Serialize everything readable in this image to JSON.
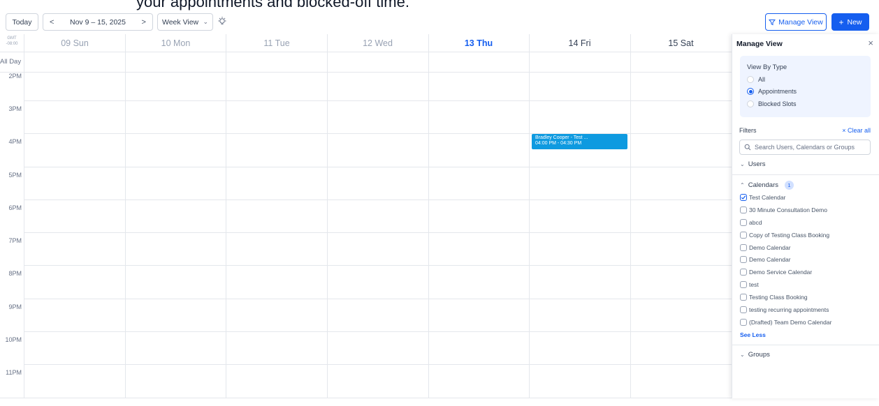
{
  "caption": "your appointments and blocked-off time.",
  "toolbar": {
    "today_label": "Today",
    "prev_arrow": "<",
    "next_arrow": ">",
    "date_range": "Nov 9 – 15, 2025",
    "view_label": "Week View",
    "manage_view_label": "Manage View",
    "new_label": "New"
  },
  "calendar": {
    "timezone": "GMT -08:00",
    "timezone_line1": "GMT",
    "timezone_line2": "-08:00",
    "allday_label": "All Day",
    "days": [
      {
        "label": "09 Sun",
        "state": "past"
      },
      {
        "label": "10 Mon",
        "state": "past"
      },
      {
        "label": "11 Tue",
        "state": "past"
      },
      {
        "label": "12 Wed",
        "state": "past"
      },
      {
        "label": "13 Thu",
        "state": "today"
      },
      {
        "label": "14 Fri",
        "state": "future"
      },
      {
        "label": "15 Sat",
        "state": "future"
      }
    ],
    "hours": [
      "2PM",
      "3PM",
      "4PM",
      "5PM",
      "6PM",
      "7PM",
      "8PM",
      "9PM",
      "10PM",
      "11PM"
    ],
    "event": {
      "title": "Bradley Cooper - Test ...",
      "time": "04:00 PM - 04:30 PM",
      "day": "14 Fri",
      "color": "#0e9ae0"
    }
  },
  "panel": {
    "title": "Manage View",
    "view_by_type_label": "View By Type",
    "view_options": [
      {
        "label": "All",
        "selected": false
      },
      {
        "label": "Appointments",
        "selected": true
      },
      {
        "label": "Blocked Slots",
        "selected": false
      }
    ],
    "filters_label": "Filters",
    "clear_all_label": "Clear all",
    "search_placeholder": "Search Users, Calendars or Groups",
    "users_label": "Users",
    "calendars_label": "Calendars",
    "calendars_count": "1",
    "calendars": [
      {
        "label": "Test Calendar",
        "checked": true
      },
      {
        "label": "30 Minute Consultation Demo",
        "checked": false
      },
      {
        "label": "abcd",
        "checked": false
      },
      {
        "label": "Copy of Testing Class Booking",
        "checked": false
      },
      {
        "label": "Demo Calendar",
        "checked": false
      },
      {
        "label": "Demo Calendar",
        "checked": false
      },
      {
        "label": "Demo Service Calendar",
        "checked": false
      },
      {
        "label": "test",
        "checked": false
      },
      {
        "label": "Testing Class Booking",
        "checked": false
      },
      {
        "label": "testing recurring appointments",
        "checked": false
      },
      {
        "label": "(Drafted) Team Demo Calendar",
        "checked": false
      }
    ],
    "see_less_label": "See Less",
    "groups_label": "Groups"
  },
  "colors": {
    "accent": "#155eef",
    "today_text": "#155eef",
    "panel_box": "#eff4ff"
  },
  "icons": [
    "chevron-left-icon",
    "chevron-right-icon",
    "chevron-down-icon",
    "lightbulb-icon",
    "filter-icon",
    "plus-icon",
    "close-icon",
    "search-icon",
    "check-icon"
  ]
}
